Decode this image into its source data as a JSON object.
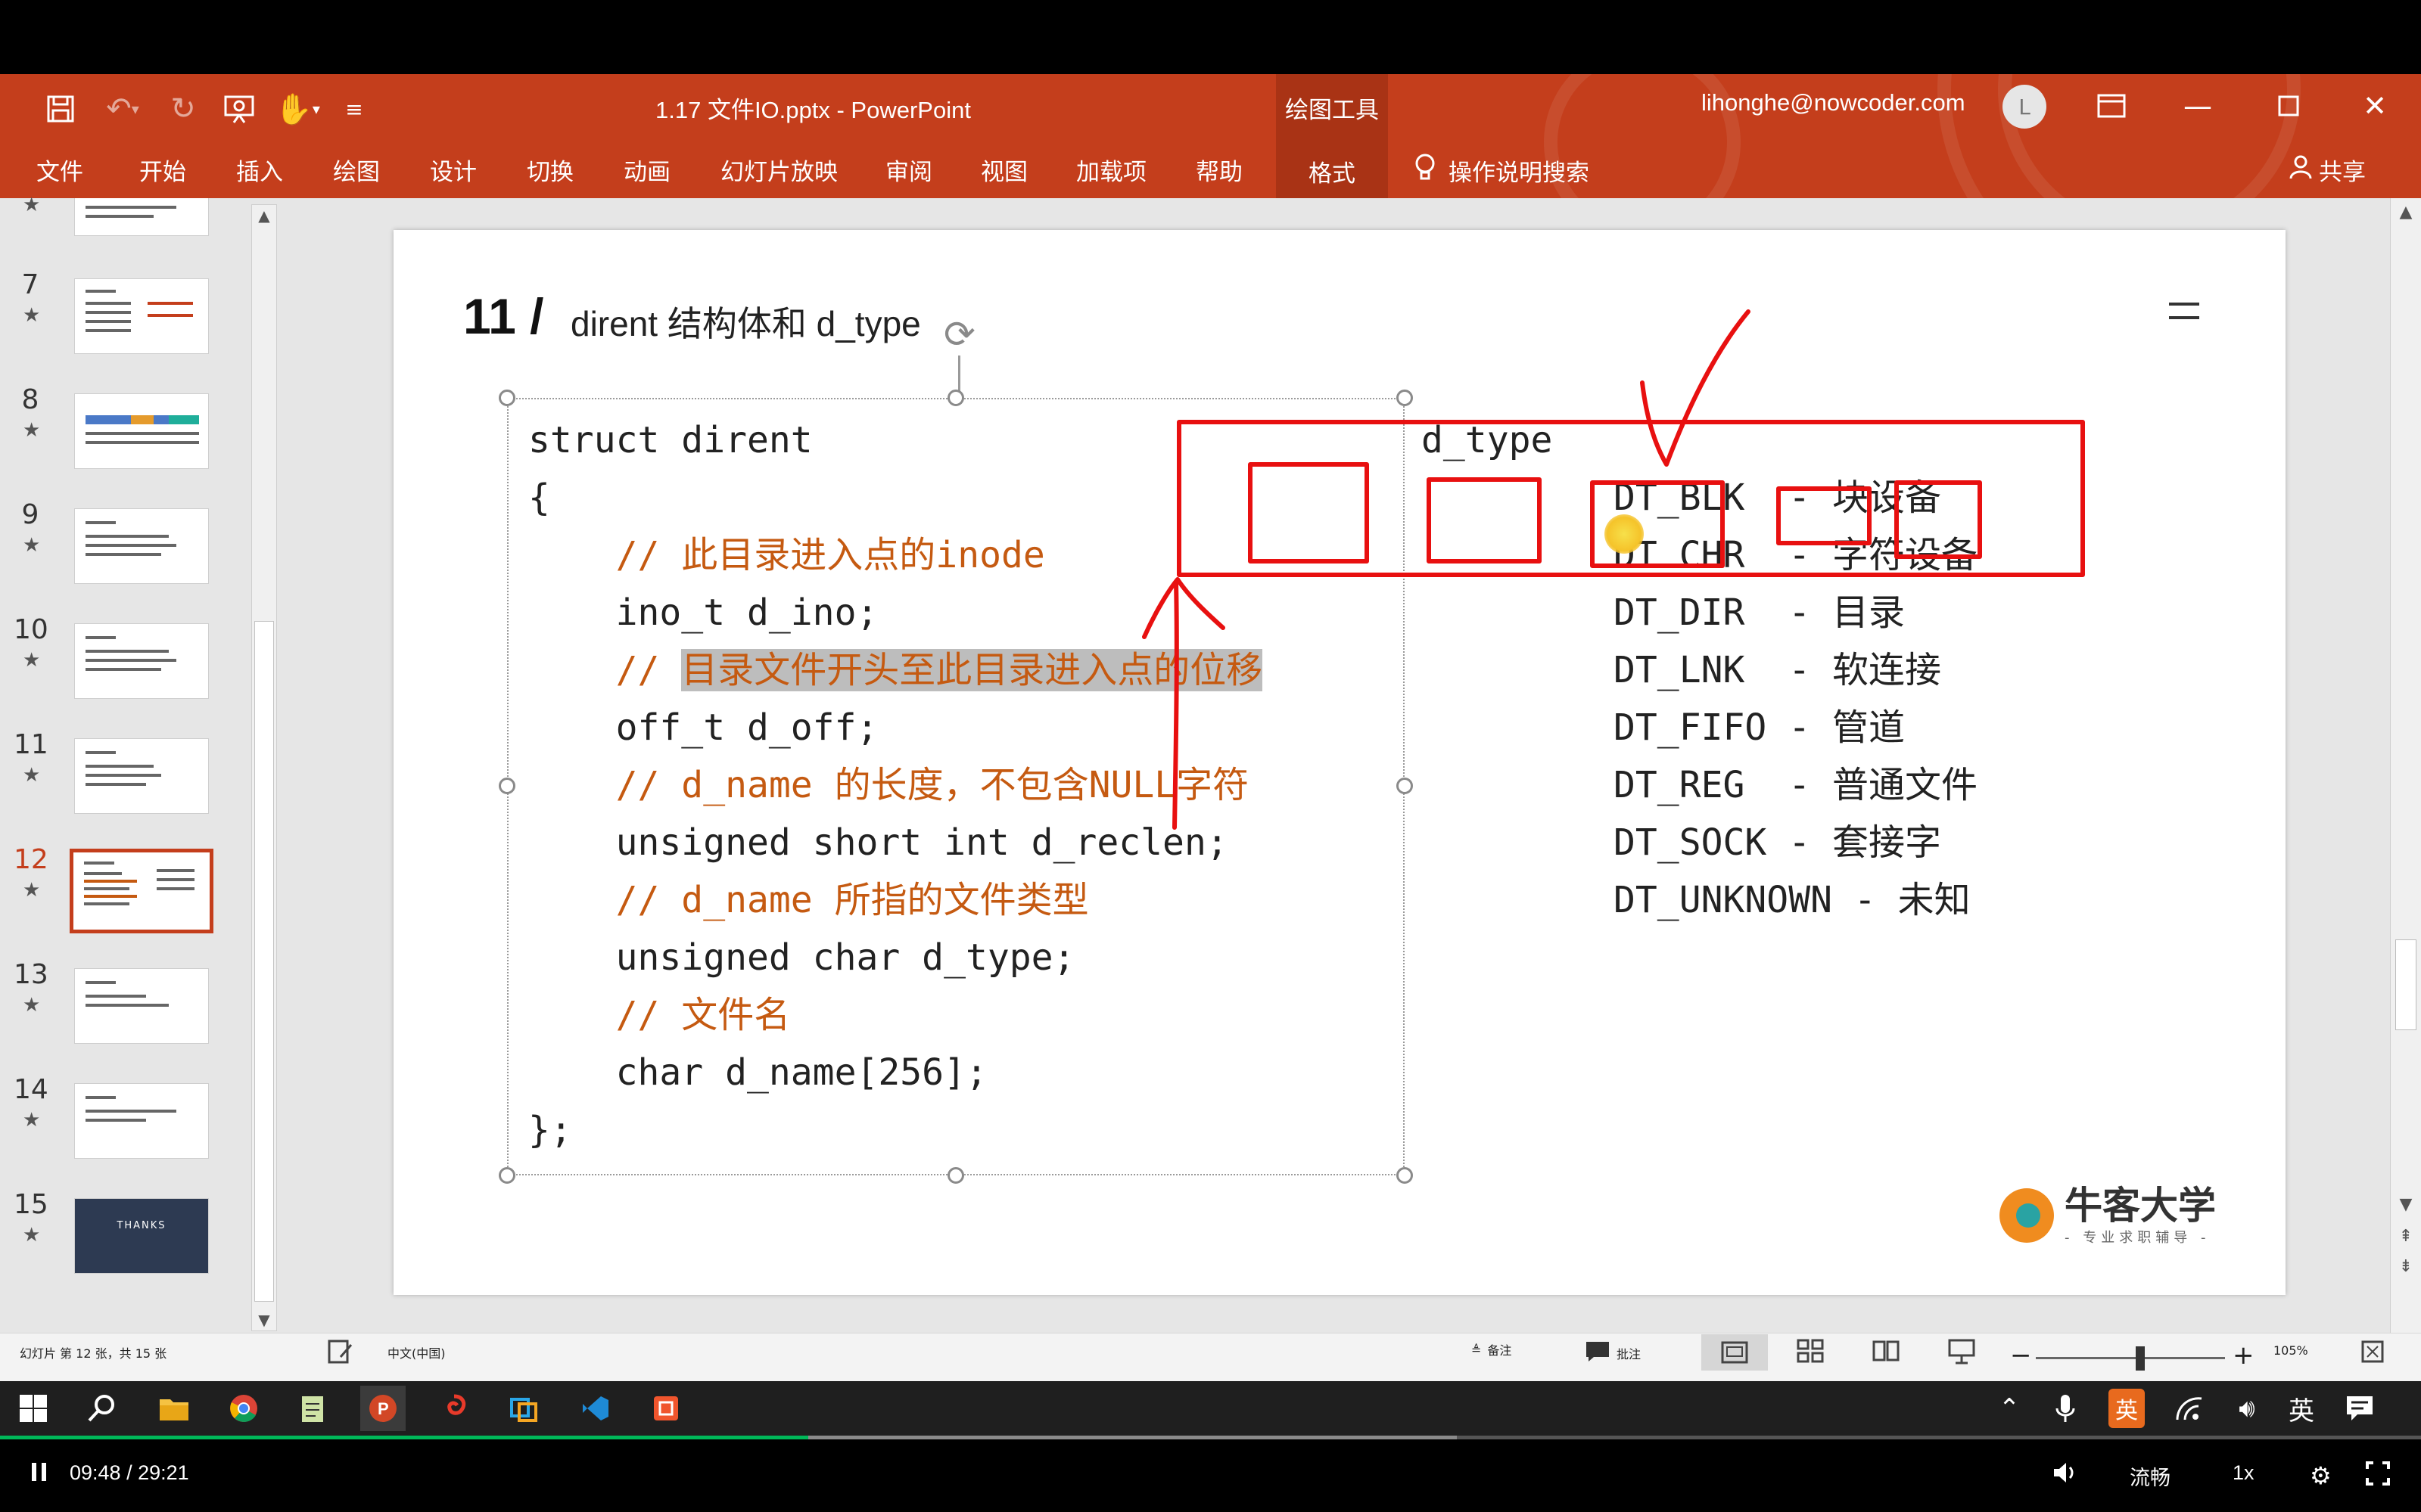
{
  "app": {
    "window_title": "1.17 文件IO.pptx  -  PowerPoint",
    "contextual_group": "绘图工具",
    "account": "lihonghe@nowcoder.com",
    "avatar_letter": "L"
  },
  "ribbon": {
    "tabs": [
      "文件",
      "开始",
      "插入",
      "绘图",
      "设计",
      "切换",
      "动画",
      "幻灯片放映",
      "审阅",
      "视图",
      "加载项",
      "帮助",
      "格式"
    ],
    "active_tab": "格式",
    "tell_me": "操作说明搜索",
    "share": "共享"
  },
  "thumbnails": {
    "slides": [
      {
        "num": "7",
        "star": "★"
      },
      {
        "num": "8",
        "star": "★"
      },
      {
        "num": "9",
        "star": "★"
      },
      {
        "num": "10",
        "star": "★"
      },
      {
        "num": "11",
        "star": "★"
      },
      {
        "num": "12",
        "star": "★"
      },
      {
        "num": "13",
        "star": "★"
      },
      {
        "num": "14",
        "star": "★"
      },
      {
        "num": "15",
        "star": "★"
      }
    ],
    "top_partial_star": "★",
    "current": "12",
    "last_thumb_text": "THANKS"
  },
  "slide": {
    "number": "11 /",
    "title": "dirent 结构体和 d_type",
    "code_lines": [
      "struct dirent",
      "{",
      "    // 此目录进入点的inode",
      "    ino_t d_ino;",
      "    // ",
      "    off_t d_off;",
      "    // d_name 的长度，不包含NULL字符",
      "    unsigned short int d_reclen;",
      "    // d_name 所指的文件类型",
      "    unsigned char d_type;",
      "    // 文件名",
      "    char d_name[256];",
      "};"
    ],
    "highlight_text": "目录文件开头至此目录进入点的位移",
    "dtype_header": "d_type",
    "dtype_lines": [
      "DT_BLK  - 块设备",
      "DT_CHR  - 字符设备",
      "DT_DIR  - 目录",
      "DT_LNK  - 软连接",
      "DT_FIFO - 管道",
      "DT_REG  - 普通文件",
      "DT_SOCK - 套接字",
      "DT_UNKNOWN - 未知"
    ],
    "logo_name": "牛客大学",
    "logo_tagline": "- 专业求职辅导 -"
  },
  "statusbar": {
    "slide_info": "幻灯片 第 12 张，共 15 张",
    "language": "中文(中国)",
    "notes": "备注",
    "comments": "批注",
    "zoom_minus": "−",
    "zoom_plus": "+",
    "zoom": "105%",
    "zoom_fraction": 0.55
  },
  "taskbar": {
    "tray_input": "英"
  },
  "player": {
    "current_time": "09:48",
    "separator": " / ",
    "total_time": "29:21",
    "quality": "流畅",
    "speed": "1x",
    "progress_fraction": 0.334
  },
  "colors": {
    "ribbon": "#c43e1c",
    "comment": "#c55a11",
    "annotation_red": "#e81010",
    "progress_green": "#00b859"
  }
}
